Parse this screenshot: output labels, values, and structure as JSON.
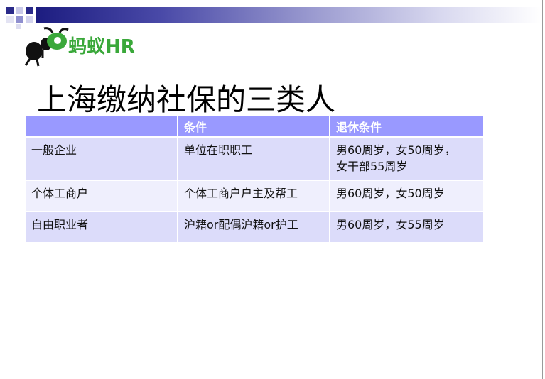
{
  "brand": {
    "logo_text": "蚂蚁HR",
    "logo_color": "#3aa83a"
  },
  "title": "上海缴纳社保的三类人",
  "table": {
    "header_color": "#9999ff",
    "headers": [
      "",
      "条件",
      "退休条件"
    ],
    "rows": [
      [
        "一般企业",
        "单位在职职工",
        "男60周岁，女50周岁，",
        "女干部55周岁"
      ],
      [
        "个体工商户",
        "个体工商户户主及帮工",
        "男60周岁，女50周岁"
      ],
      [
        "自由职业者",
        "沪籍or配偶沪籍or护工",
        "男60周岁，女55周岁"
      ]
    ]
  }
}
